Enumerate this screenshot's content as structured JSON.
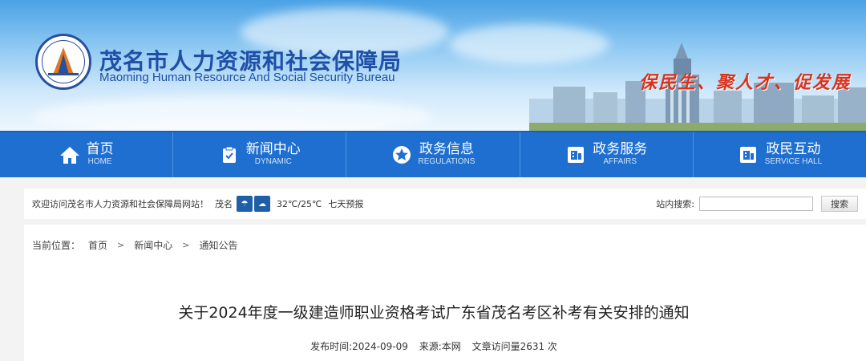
{
  "header": {
    "title_cn": "茂名市人力资源和社会保障局",
    "title_en": "Maoming Human Resource And Social Security Bureau",
    "slogan": "保民生、聚人才、促发展"
  },
  "nav": {
    "items": [
      {
        "label": "首页",
        "sub": "HOME",
        "icon": "home-icon"
      },
      {
        "label": "新闻中心",
        "sub": "DYNAMIC",
        "icon": "news-icon"
      },
      {
        "label": "政务信息",
        "sub": "REGULATIONS",
        "icon": "star-icon"
      },
      {
        "label": "政务服务",
        "sub": "AFFAIRS",
        "icon": "service-icon"
      },
      {
        "label": "政民互动",
        "sub": "SERVICE HALL",
        "icon": "interact-icon"
      }
    ]
  },
  "infobar": {
    "welcome": "欢迎访问茂名市人力资源和社会保障局网站！",
    "city": "茂名",
    "temperature": "32℃/25℃",
    "forecast": "七天预报",
    "search_label": "站内搜索:",
    "search_placeholder": "",
    "search_button": "搜索"
  },
  "breadcrumb": {
    "prefix": "当前位置：",
    "items": [
      "首页",
      "新闻中心",
      "通知公告"
    ],
    "separator": ">"
  },
  "article": {
    "title": "关于2024年度一级建造师职业资格考试广东省茂名考区补考有关安排的通知",
    "publish_time": "发布时间:2024-09-09",
    "source": "来源:本网",
    "views": "文章访问量2631 次"
  },
  "colors": {
    "nav_bg": "#1f6fd0",
    "title_blue": "#1f4fa6",
    "slogan_red": "#d9331e"
  }
}
